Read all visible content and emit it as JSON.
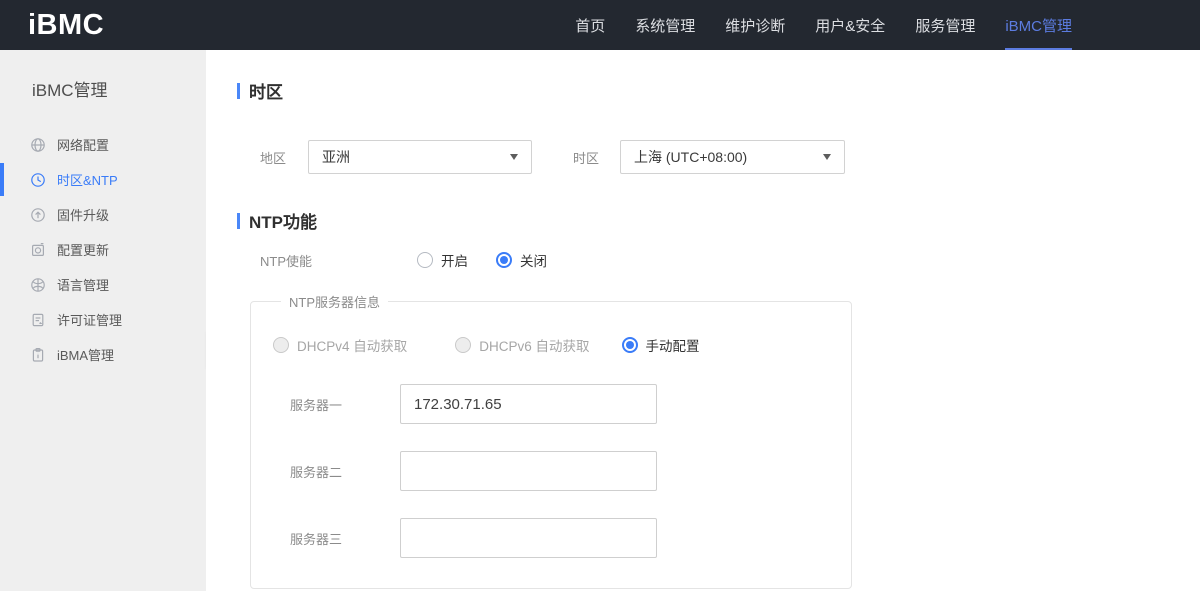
{
  "navbar": {
    "logo": "iBMC",
    "items": [
      {
        "label": "首页",
        "active": false
      },
      {
        "label": "系统管理",
        "active": false
      },
      {
        "label": "维护诊断",
        "active": false
      },
      {
        "label": "用户&安全",
        "active": false
      },
      {
        "label": "服务管理",
        "active": false
      },
      {
        "label": "iBMC管理",
        "active": true
      }
    ]
  },
  "sidebar": {
    "title": "iBMC管理",
    "items": [
      {
        "label": "网络配置",
        "icon": "globe-icon",
        "active": false
      },
      {
        "label": "时区&NTP",
        "icon": "clock-icon",
        "active": true
      },
      {
        "label": "固件升级",
        "icon": "upload-circle-icon",
        "active": false
      },
      {
        "label": "配置更新",
        "icon": "config-update-icon",
        "active": false
      },
      {
        "label": "语言管理",
        "icon": "language-icon",
        "active": false
      },
      {
        "label": "许可证管理",
        "icon": "license-icon",
        "active": false
      },
      {
        "label": "iBMA管理",
        "icon": "clipboard-icon",
        "active": false
      }
    ]
  },
  "timezone_section": {
    "title": "时区",
    "region_label": "地区",
    "region_value": "亚洲",
    "timezone_label": "时区",
    "timezone_value": "上海 (UTC+08:00)"
  },
  "ntp_section": {
    "title": "NTP功能",
    "enable_label": "NTP使能",
    "enable_options": [
      {
        "label": "开启",
        "selected": false
      },
      {
        "label": "关闭",
        "selected": true
      }
    ],
    "server_info": {
      "legend": "NTP服务器信息",
      "mode_options": [
        {
          "label": "DHCPv4 自动获取",
          "selected": false,
          "disabled": true
        },
        {
          "label": "DHCPv6 自动获取",
          "selected": false,
          "disabled": true
        },
        {
          "label": "手动配置",
          "selected": true,
          "disabled": false
        }
      ],
      "servers": [
        {
          "label": "服务器一",
          "value": "172.30.71.65"
        },
        {
          "label": "服务器二",
          "value": ""
        },
        {
          "label": "服务器三",
          "value": ""
        }
      ]
    }
  },
  "colors": {
    "accent": "#3a7cf8",
    "navbar_bg": "#232830",
    "nav_active": "#5c7ce0",
    "sidebar_bg": "#efefef"
  }
}
